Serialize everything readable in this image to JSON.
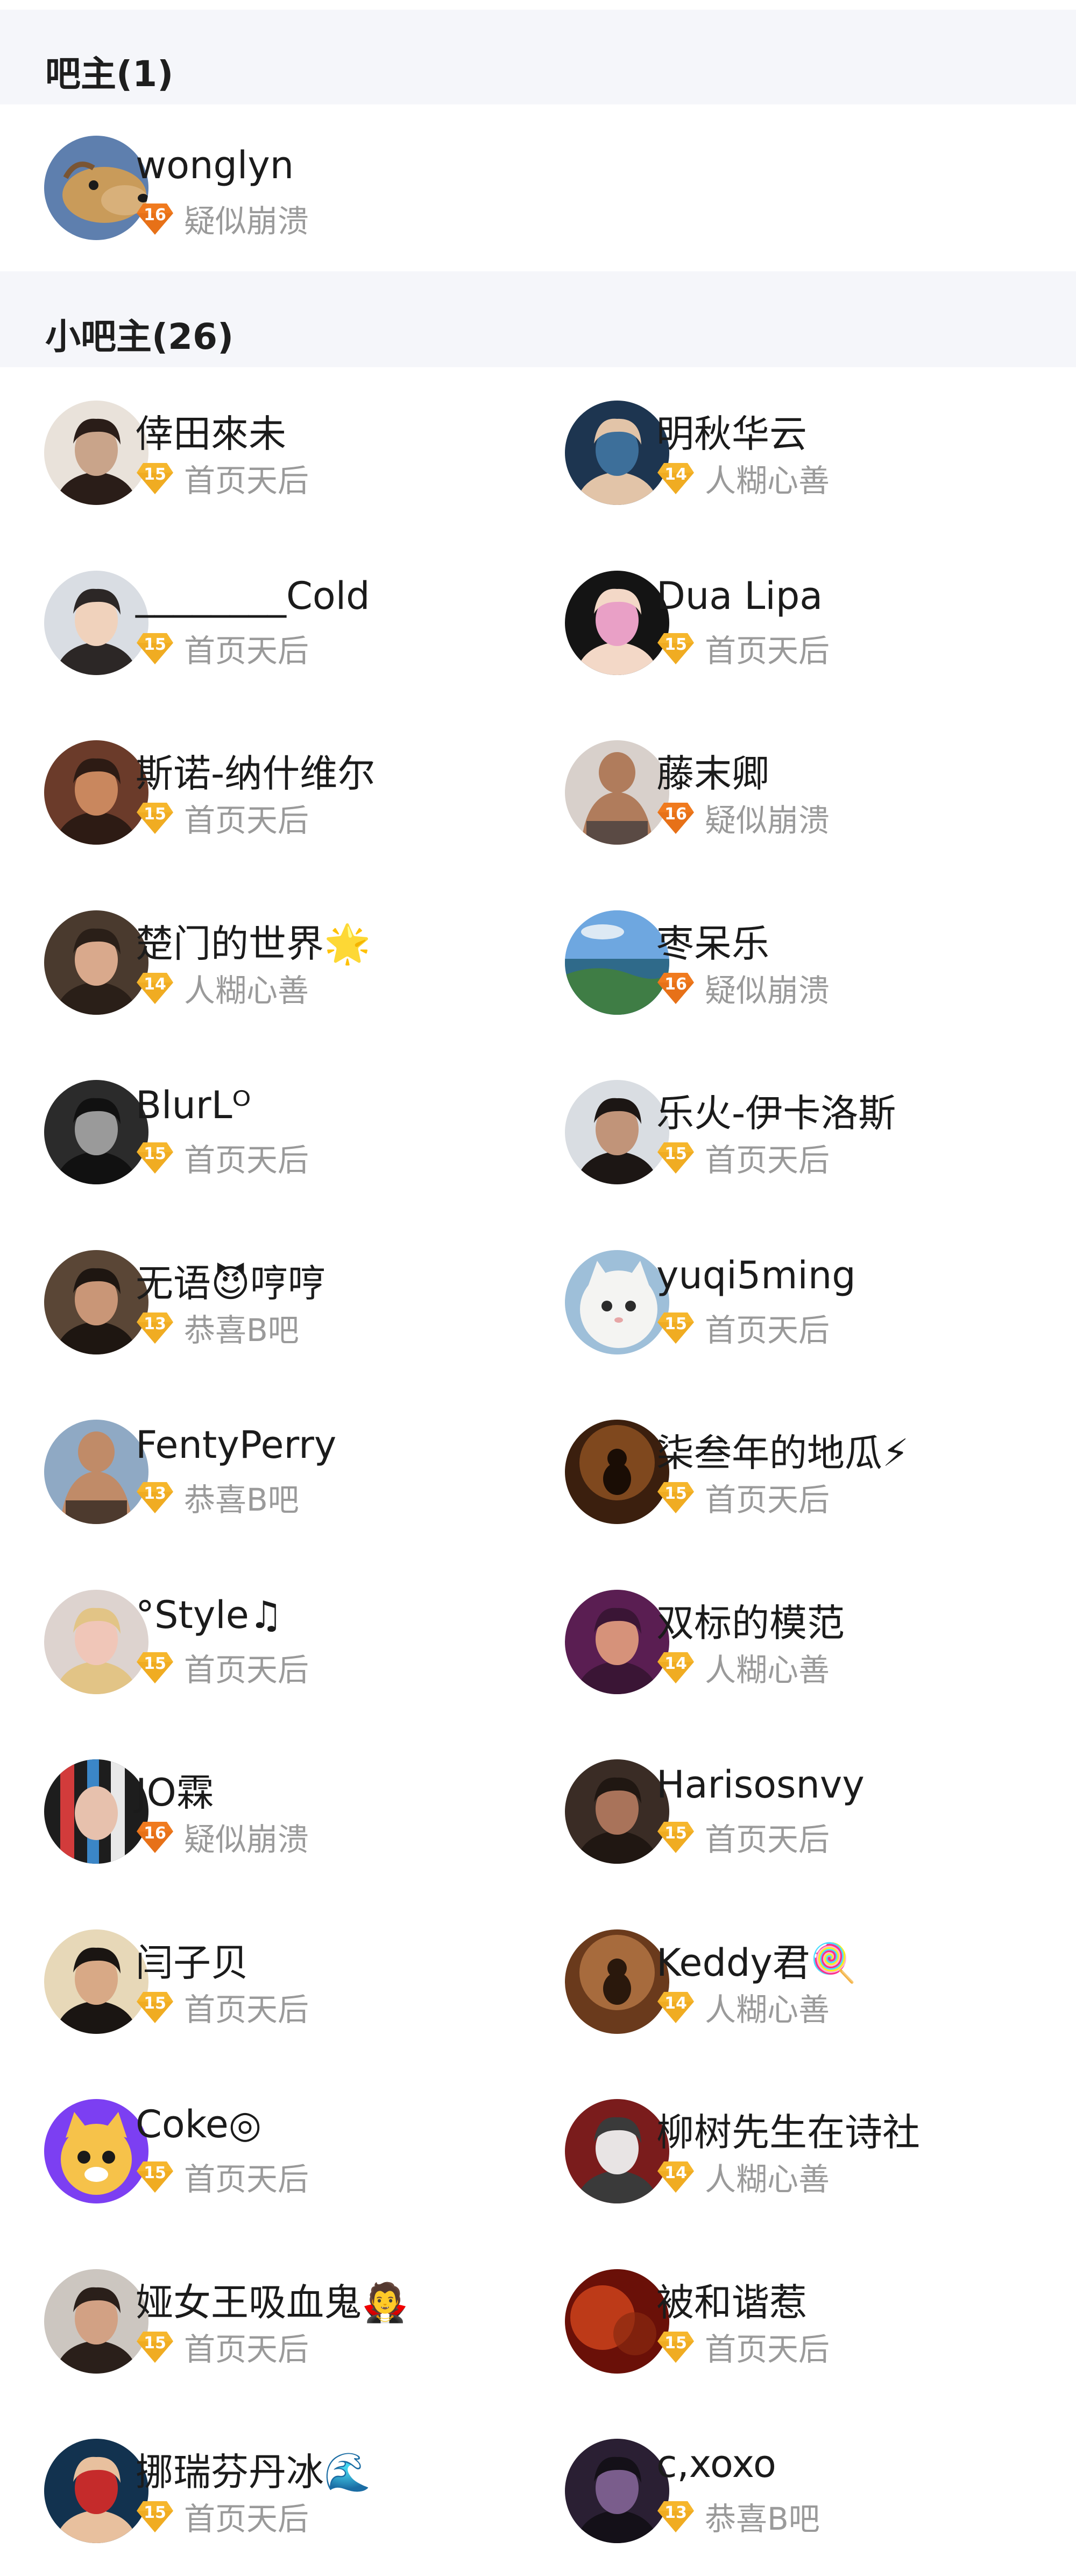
{
  "colors": {
    "section_bg": "#f5f6fa",
    "title_text": "#1e1e1e",
    "name_text": "#1b1b1b",
    "level_text": "#9a9a9a",
    "badge_yellow": "#f6b62c",
    "badge_orange": "#f07a1e"
  },
  "admin_section": {
    "title": "吧主(1)",
    "members": [
      {
        "name": "wonglyn",
        "level": "16",
        "level_title": "疑似崩溃",
        "badge": "orange",
        "avatar": "dog-avatar"
      }
    ]
  },
  "sub_section": {
    "title": "小吧主(26)",
    "members": [
      {
        "name": "倖田來未",
        "level": "15",
        "level_title": "首页天后",
        "badge": "yellow",
        "avatar": "woman-short-hair-avatar"
      },
      {
        "name": "明秋华云",
        "level": "14",
        "level_title": "人糊心善",
        "badge": "yellow",
        "avatar": "singer-avatar"
      },
      {
        "name": "________Cold",
        "level": "15",
        "level_title": "首页天后",
        "badge": "yellow",
        "avatar": "young-man-avatar"
      },
      {
        "name": "Dua Lipa",
        "level": "15",
        "level_title": "首页天后",
        "badge": "yellow",
        "avatar": "pink-hair-avatar"
      },
      {
        "name": "斯诺-纳什维尔",
        "level": "15",
        "level_title": "首页天后",
        "badge": "yellow",
        "avatar": "illustration-avatar"
      },
      {
        "name": "藤末卿",
        "level": "16",
        "level_title": "疑似崩溃",
        "badge": "orange",
        "avatar": "torso-avatar"
      },
      {
        "name": "楚门的世界🌟",
        "level": "14",
        "level_title": "人糊心善",
        "badge": "yellow",
        "avatar": "actor-avatar"
      },
      {
        "name": "枣呆乐",
        "level": "16",
        "level_title": "疑似崩溃",
        "badge": "orange",
        "avatar": "landscape-avatar"
      },
      {
        "name": "BlurLᴼ",
        "level": "15",
        "level_title": "首页天后",
        "badge": "yellow",
        "avatar": "bw-portrait-avatar"
      },
      {
        "name": "乐火-伊卡洛斯",
        "level": "15",
        "level_title": "首页天后",
        "badge": "yellow",
        "avatar": "bearded-man-avatar"
      },
      {
        "name": "无语😈哼哼",
        "level": "13",
        "level_title": "恭喜B吧",
        "badge": "yellow",
        "avatar": "man-curly-hair-avatar"
      },
      {
        "name": "yuqi5ming",
        "level": "15",
        "level_title": "首页天后",
        "badge": "yellow",
        "avatar": "white-cat-avatar"
      },
      {
        "name": "FentyPerry",
        "level": "13",
        "level_title": "恭喜B吧",
        "badge": "yellow",
        "avatar": "beach-man-avatar"
      },
      {
        "name": "柒叁年的地瓜⚡",
        "level": "15",
        "level_title": "首页天后",
        "badge": "yellow",
        "avatar": "stage-avatar"
      },
      {
        "name": "°Style♫",
        "level": "15",
        "level_title": "首页天后",
        "badge": "yellow",
        "avatar": "blonde-woman-avatar"
      },
      {
        "name": "双标的模范",
        "level": "14",
        "level_title": "人糊心善",
        "badge": "yellow",
        "avatar": "purple-man-avatar"
      },
      {
        "name": "JO霖",
        "level": "16",
        "level_title": "疑似崩溃",
        "badge": "orange",
        "avatar": "colorful-avatar"
      },
      {
        "name": "Harisosnvy",
        "level": "15",
        "level_title": "首页天后",
        "badge": "yellow",
        "avatar": "couple-avatar"
      },
      {
        "name": "闫子贝",
        "level": "15",
        "level_title": "首页天后",
        "badge": "yellow",
        "avatar": "boy-dog-filter-avatar"
      },
      {
        "name": "Keddy君🍭",
        "level": "14",
        "level_title": "人糊心善",
        "badge": "yellow",
        "avatar": "warm-room-avatar"
      },
      {
        "name": "Coke◎",
        "level": "15",
        "level_title": "首页天后",
        "badge": "yellow",
        "avatar": "cartoon-cat-avatar"
      },
      {
        "name": "柳树先生在诗社",
        "level": "14",
        "level_title": "人糊心善",
        "badge": "yellow",
        "avatar": "anime-avatar"
      },
      {
        "name": "娅女王吸血鬼🧛",
        "level": "15",
        "level_title": "首页天后",
        "badge": "yellow",
        "avatar": "young-man-2-avatar"
      },
      {
        "name": "被和谐惹",
        "level": "15",
        "level_title": "首页天后",
        "badge": "yellow",
        "avatar": "red-blur-avatar"
      },
      {
        "name": "挪瑞芬丹冰🌊",
        "level": "15",
        "level_title": "首页天后",
        "badge": "yellow",
        "avatar": "soccer-player-avatar"
      },
      {
        "name": "c,xoxo",
        "level": "13",
        "level_title": "恭喜B吧",
        "badge": "yellow",
        "avatar": "dark-purple-avatar"
      }
    ]
  }
}
